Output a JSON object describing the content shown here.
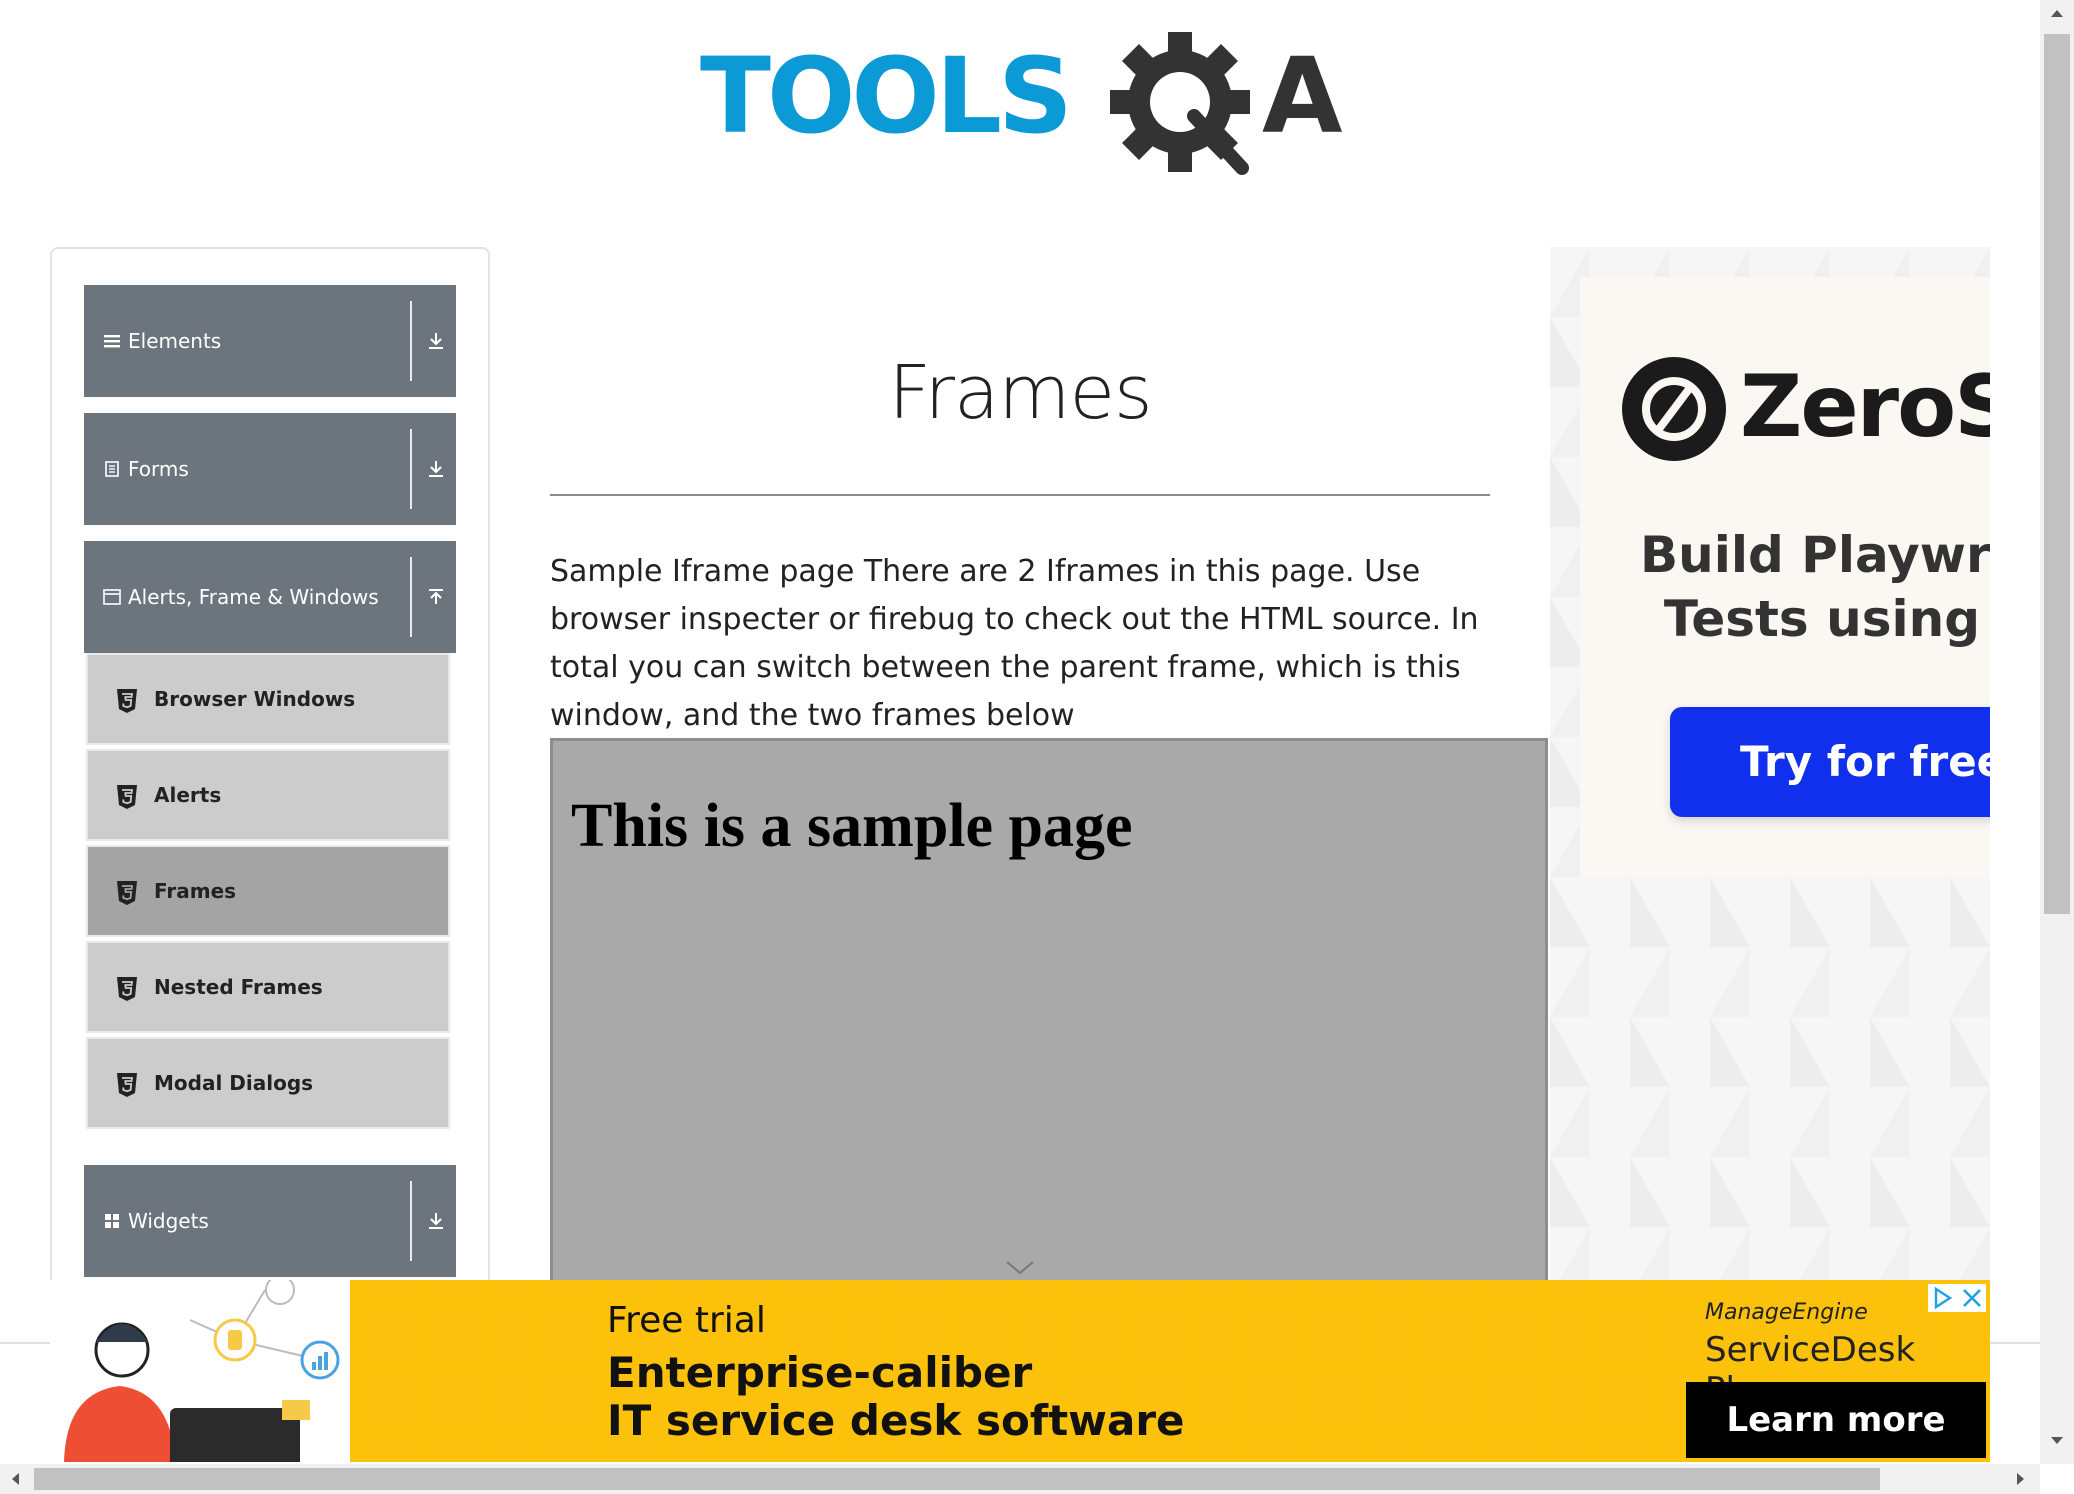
{
  "header": {
    "logo_text_left": "TOOLS",
    "logo_text_right": "A",
    "colors": {
      "logo_blue": "#0c9ad6",
      "logo_dark": "#333333"
    }
  },
  "sidebar": {
    "groups": [
      {
        "label": "Elements",
        "icon": "list-icon",
        "arrow": "download-arrow-icon"
      },
      {
        "label": "Forms",
        "icon": "form-icon",
        "arrow": "download-arrow-icon"
      },
      {
        "label": "Alerts, Frame & Windows",
        "icon": "window-icon",
        "arrow": "upload-arrow-icon"
      },
      {
        "label": "Widgets",
        "icon": "grid-icon",
        "arrow": "download-arrow-icon"
      }
    ],
    "items": [
      {
        "label": "Browser Windows",
        "icon": "html5-icon",
        "active": false
      },
      {
        "label": "Alerts",
        "icon": "html5-icon",
        "active": false
      },
      {
        "label": "Frames",
        "icon": "html5-icon",
        "active": true
      },
      {
        "label": "Nested Frames",
        "icon": "html5-icon",
        "active": false
      },
      {
        "label": "Modal Dialogs",
        "icon": "html5-icon",
        "active": false
      }
    ],
    "colors": {
      "group_bg": "#6c757d",
      "item_bg": "#cccccc",
      "item_active_bg": "#a4a4a4"
    }
  },
  "main": {
    "title": "Frames",
    "intro": "Sample Iframe page There are 2 Iframes in this page. Use browser inspecter or firebug to check out the HTML source. In total you can switch between the parent frame, which is this window, and the two frames below",
    "iframe": {
      "heading": "This is a sample page",
      "background": "#a9a9a9"
    }
  },
  "right_ad": {
    "brand": "ZeroSte",
    "tagline": "Build Playwrigl\nTests using A",
    "cta": "Try for free →",
    "colors": {
      "cta_bg": "#1130ee"
    }
  },
  "bottom_banner": {
    "line1": "Free trial",
    "line2": "Enterprise-caliber",
    "line3": "IT service desk software",
    "brand_small": "ManageEngine",
    "brand": "ServiceDesk Plus",
    "cta": "Learn more",
    "colors": {
      "bg": "#fcc10a",
      "cta_bg": "#000000"
    }
  }
}
